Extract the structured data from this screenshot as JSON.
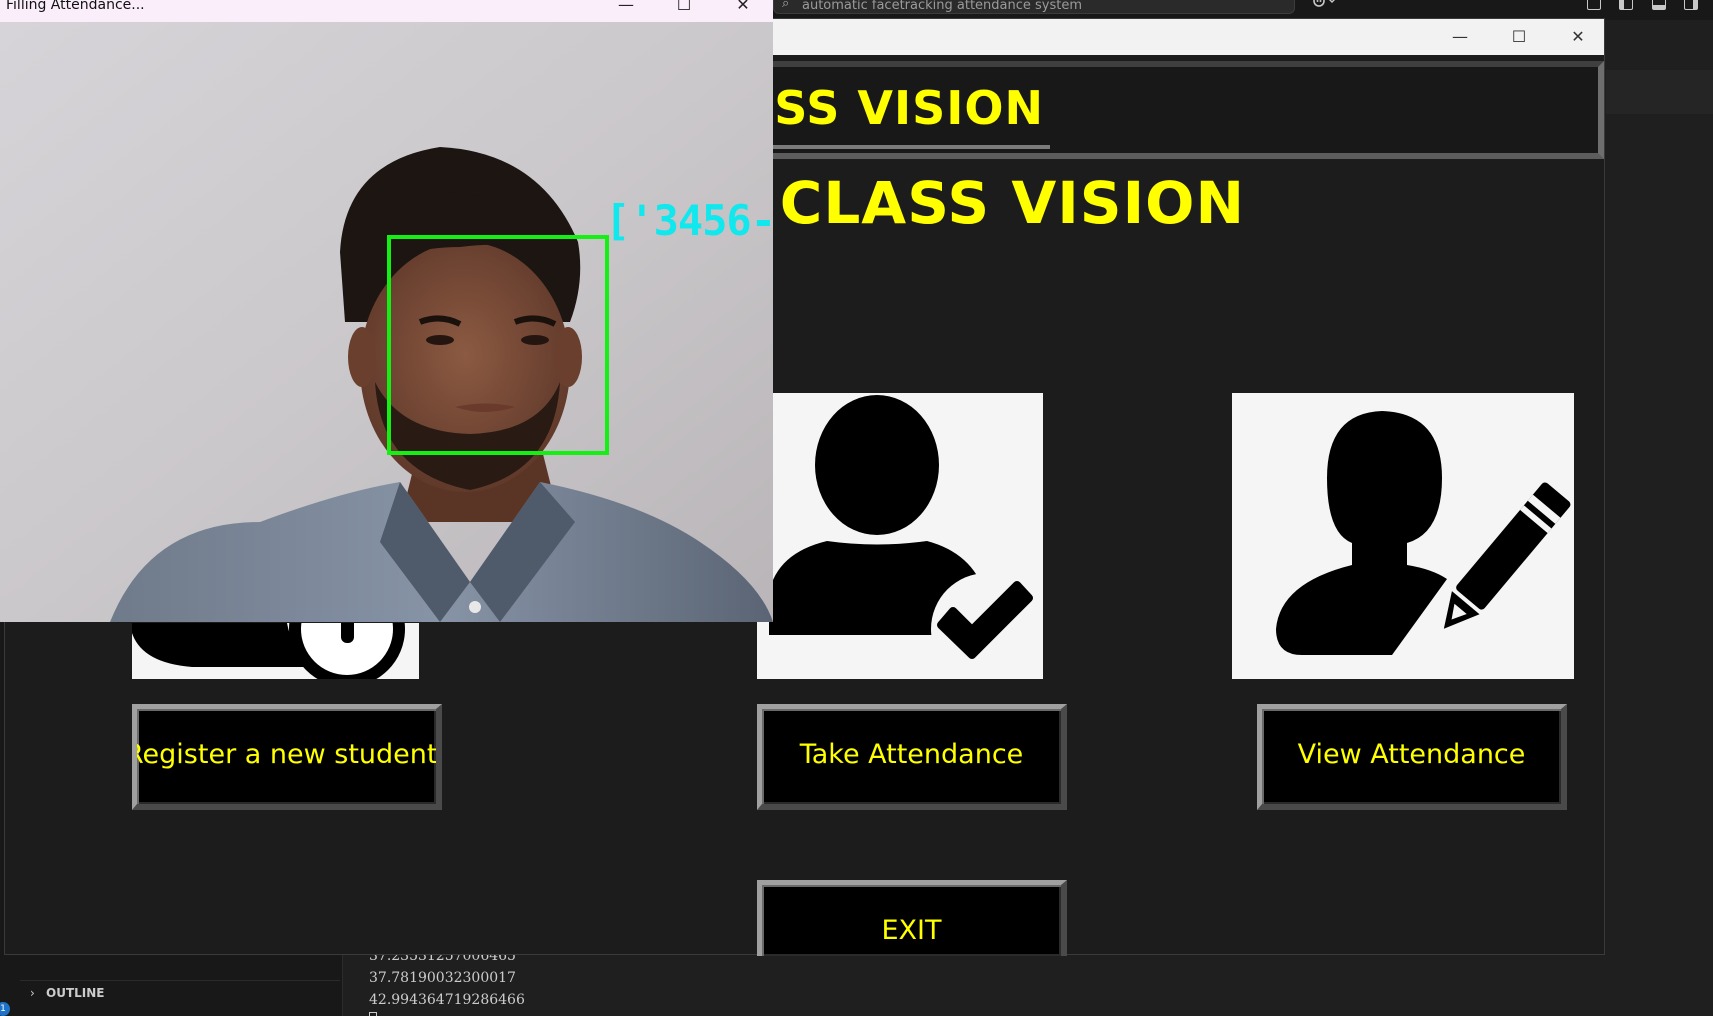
{
  "vscode": {
    "search_text": "automatic facetracking attendance system",
    "copilot_icon": "copilot-icon",
    "outline_label": "OUTLINE",
    "terminal_lines": [
      "37.23531257006465",
      "37.78190032300017",
      "42.994364719286466"
    ],
    "badge": "1"
  },
  "app_window": {
    "minimize_glyph": "—",
    "maximize_glyph": "☐",
    "close_glyph": "✕",
    "header_title": "CLASS VISION",
    "title": "CLASS VISION",
    "buttons": {
      "register": "Register a new student",
      "take": "Take Attendance",
      "view": "View Attendance",
      "exit": "EXIT"
    },
    "icons": {
      "register": "user-add-icon",
      "take": "user-check-icon",
      "view": "user-edit-icon"
    }
  },
  "capture_window": {
    "title": "Filling Attendance...",
    "minimize_glyph": "—",
    "maximize_glyph": "☐",
    "close_glyph": "✕",
    "face_label": "['3456-"
  },
  "colors": {
    "accent_yellow": "#ffff00",
    "face_box": "#14f014",
    "face_label": "#10e8ee"
  }
}
